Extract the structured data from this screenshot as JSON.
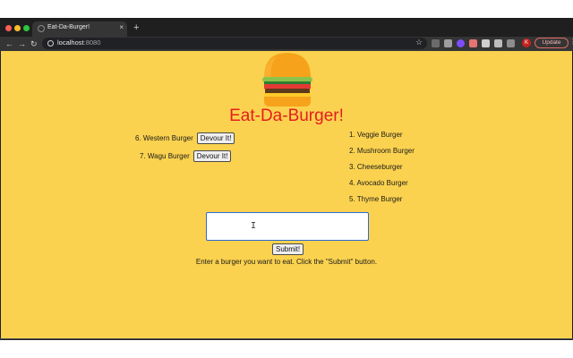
{
  "browser": {
    "tab_title": "Eat-Da-Burger!",
    "tab_close": "×",
    "new_tab": "+",
    "url_host": "localhost",
    "url_port": ":8080",
    "avatar_letter": "K",
    "update_label": "Update",
    "kebab": "⋮",
    "back": "←",
    "forward": "→",
    "reload": "↻",
    "star": "☆",
    "colors": {
      "close": "#ff5f57",
      "minimize": "#febc2e",
      "maximize": "#28c840"
    }
  },
  "page": {
    "title": "Eat-Da-Burger!",
    "background": "#fbd24f",
    "title_color": "#e41e1e",
    "logo_icon": "burger-icon",
    "devour_button_label": "Devour It!",
    "to_devour": [
      {
        "label": "6. Western Burger"
      },
      {
        "label": "7. Wagu Burger"
      }
    ],
    "devoured": [
      "1. Veggie Burger",
      "2. Mushroom Burger",
      "3. Cheeseburger",
      "4. Avocado Burger",
      "5. Thyme Burger"
    ],
    "input_value": "",
    "input_placeholder": "",
    "text_cursor": "I",
    "submit_label": "Submit!",
    "instructions": "Enter a burger you want to eat. Click the \"Submit\" button."
  }
}
